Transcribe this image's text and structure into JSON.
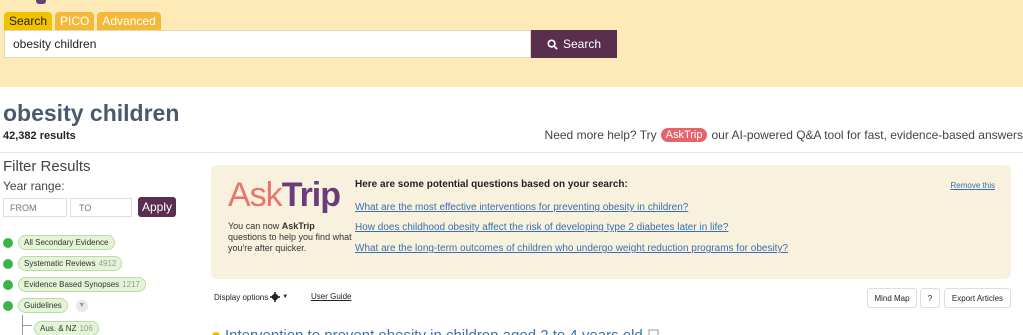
{
  "header": {
    "tabs": [
      {
        "label": "Search",
        "active": true
      },
      {
        "label": "PICO",
        "active": false
      },
      {
        "label": "Advanced",
        "active": false
      }
    ],
    "search_value": "obesity children",
    "search_button": "Search"
  },
  "results": {
    "title": "obesity children",
    "count": "42,382 results"
  },
  "help": {
    "prefix": "Need more help? Try",
    "pill": "AskTrip",
    "suffix": "our AI-powered Q&A tool for fast, evidence-based answers"
  },
  "sidebar": {
    "title": "Filter Results",
    "year_label": "Year range:",
    "from_placeholder": "FROM",
    "to_placeholder": "TO",
    "apply": "Apply",
    "filters": [
      {
        "label": "All Secondary Evidence",
        "count": ""
      },
      {
        "label": "Systematic Reviews",
        "count": "4912"
      },
      {
        "label": "Evidence Based Synopses",
        "count": "1217"
      },
      {
        "label": "Guidelines",
        "count": ""
      }
    ],
    "sub_filters": [
      {
        "label": "Aus. & NZ",
        "count": "106"
      }
    ]
  },
  "asktrip": {
    "logo_ask": "Ask",
    "logo_trip": "Trip",
    "blurb_prefix": "You can now",
    "blurb_bold": "AskTrip",
    "blurb_suffix": "questions to help you find what you're after quicker.",
    "heading": "Here are some potential questions based on your search:",
    "remove": "Remove this",
    "questions": [
      "What are the most effective interventions for preventing obesity in children?",
      "How does childhood obesity affect the risk of developing type 2 diabetes later in life?",
      "What are the long-term outcomes of children who undergo weight reduction programs for obesity?"
    ]
  },
  "toolbar": {
    "display_options": "Display options",
    "user_guide": "User Guide",
    "mind_map": "Mind Map",
    "help": "?",
    "export": "Export Articles"
  },
  "first_result": {
    "title": "Intervention to prevent obesity in children aged 2 to 4 years old"
  },
  "colors": {
    "header_bg": "#fdeab6",
    "accent_purple": "#5a2e4e",
    "filter_green": "#39b54a",
    "link_blue": "#3a6fb0",
    "asktrip_coral": "#e5646c"
  },
  "icons": [
    "search-icon",
    "gear-icon",
    "chevron-down-icon",
    "document-icon"
  ]
}
